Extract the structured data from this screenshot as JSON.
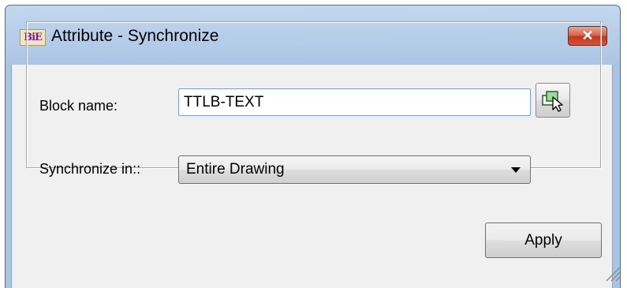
{
  "window": {
    "title": "Attribute - Synchronize",
    "app_icon_text": "BiE",
    "close_symbol": "✕"
  },
  "form": {
    "block_name_label": "Block name:",
    "block_name_value": "TTLB-TEXT",
    "pick_icon": "select-object-icon",
    "synchronize_label": "Synchronize in::",
    "synchronize_value": "Entire Drawing"
  },
  "buttons": {
    "apply_label": "Apply"
  },
  "colors": {
    "title_bar": "#b9cfea",
    "close_button": "#c4381c",
    "dialog_background": "#f0f0f0"
  }
}
